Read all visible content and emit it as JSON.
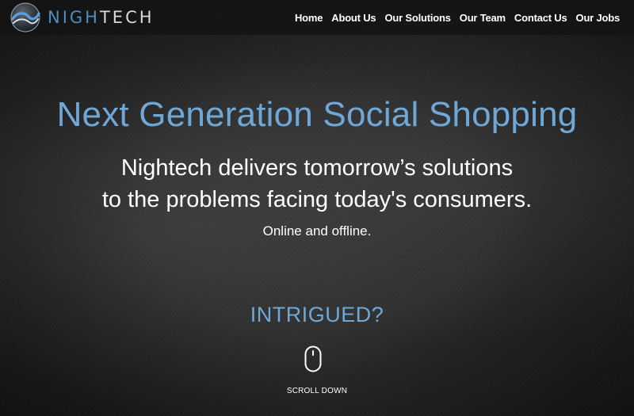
{
  "brand": {
    "name_part_a": "NIGH",
    "name_part_b": "TECH",
    "accent_color": "#4d8dc4"
  },
  "nav": {
    "items": [
      {
        "label": "Home"
      },
      {
        "label": "About Us"
      },
      {
        "label": "Our Solutions"
      },
      {
        "label": "Our Team"
      },
      {
        "label": "Contact Us"
      },
      {
        "label": "Our Jobs"
      }
    ]
  },
  "hero": {
    "headline": "Next Generation Social Shopping",
    "line1": "Nightech delivers tomorrow’s solutions",
    "line2": "to the problems facing today's consumers.",
    "line3": "Online and offline."
  },
  "cta": {
    "label": "INTRIGUED?",
    "scroll_label": "SCROLL DOWN",
    "icon": "mouse-icon"
  }
}
